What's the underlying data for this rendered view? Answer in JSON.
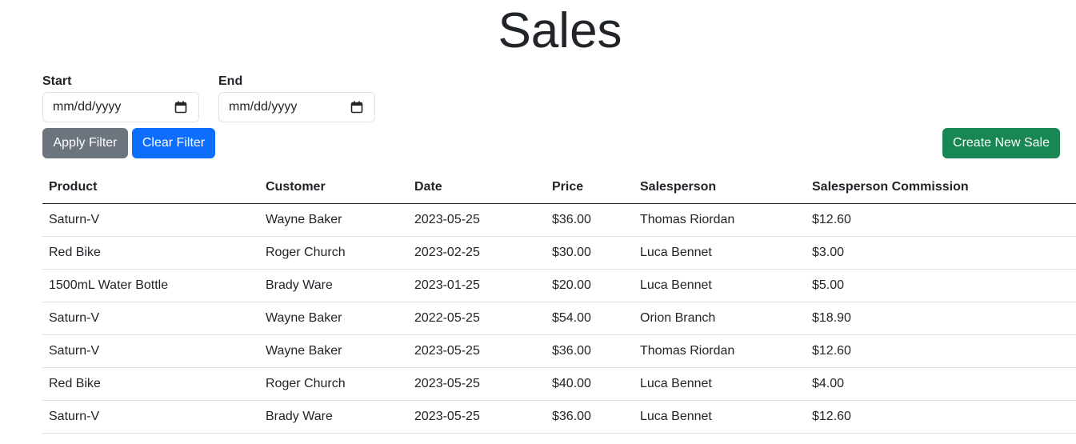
{
  "page": {
    "title": "Sales"
  },
  "filters": {
    "start_label": "Start",
    "start_placeholder": "mm/dd/yyyy",
    "end_label": "End",
    "end_placeholder": "mm/dd/yyyy",
    "apply_label": "Apply Filter",
    "clear_label": "Clear Filter"
  },
  "actions": {
    "create_label": "Create New Sale"
  },
  "colors": {
    "apply": "#6c757d",
    "clear": "#0d6efd",
    "create": "#198754"
  },
  "table": {
    "headers": [
      "Product",
      "Customer",
      "Date",
      "Price",
      "Salesperson",
      "Salesperson Commission"
    ],
    "rows": [
      [
        "Saturn-V",
        "Wayne Baker",
        "2023-05-25",
        "$36.00",
        "Thomas Riordan",
        "$12.60"
      ],
      [
        "Red Bike",
        "Roger Church",
        "2023-02-25",
        "$30.00",
        "Luca Bennet",
        "$3.00"
      ],
      [
        "1500mL Water Bottle",
        "Brady Ware",
        "2023-01-25",
        "$20.00",
        "Luca Bennet",
        "$5.00"
      ],
      [
        "Saturn-V",
        "Wayne Baker",
        "2022-05-25",
        "$54.00",
        "Orion Branch",
        "$18.90"
      ],
      [
        "Saturn-V",
        "Wayne Baker",
        "2023-05-25",
        "$36.00",
        "Thomas Riordan",
        "$12.60"
      ],
      [
        "Red Bike",
        "Roger Church",
        "2023-05-25",
        "$40.00",
        "Luca Bennet",
        "$4.00"
      ],
      [
        "Saturn-V",
        "Brady Ware",
        "2023-05-25",
        "$36.00",
        "Luca Bennet",
        "$12.60"
      ]
    ]
  }
}
